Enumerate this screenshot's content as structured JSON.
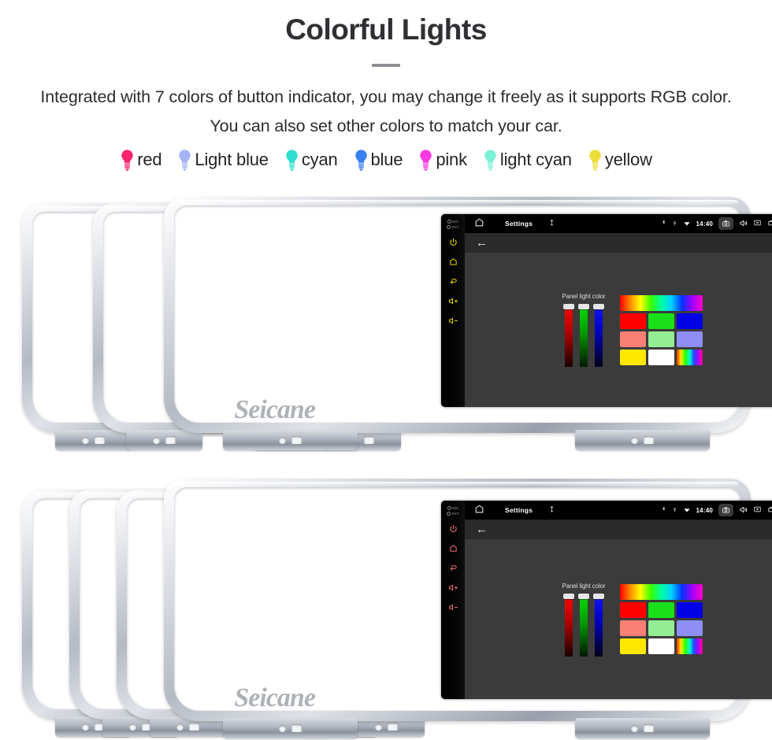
{
  "header": {
    "title": "Colorful Lights",
    "subtitle": "Integrated with 7 colors of button indicator, you may change it freely as it supports RGB color. You can also set other colors to match your car."
  },
  "legend": {
    "items": [
      {
        "label": "red",
        "color": "#f8246a",
        "icon": "bulb-icon"
      },
      {
        "label": "Light blue",
        "color": "#a5b4f5",
        "icon": "bulb-icon"
      },
      {
        "label": "cyan",
        "color": "#2fded0",
        "icon": "bulb-icon"
      },
      {
        "label": "blue",
        "color": "#3a7ff0",
        "icon": "bulb-icon"
      },
      {
        "label": "pink",
        "color": "#f93ae0",
        "icon": "bulb-icon"
      },
      {
        "label": "light cyan",
        "color": "#7df2d6",
        "icon": "bulb-icon"
      },
      {
        "label": "yellow",
        "color": "#ecdd3a",
        "icon": "bulb-icon"
      }
    ]
  },
  "screen": {
    "statusbar": {
      "home_icon": "home-icon",
      "title": "Settings",
      "mic_icon": "microphone-icon",
      "bluetooth_icon": "bluetooth-icon",
      "location_icon": "location-pin-icon",
      "wifi_icon": "wifi-icon",
      "time": "14:40",
      "camera_icon": "camera-icon",
      "volume_icon": "speaker-icon",
      "close_icon": "close-box-icon",
      "recents_icon": "recents-icon",
      "back_icon": "back-arrow-icon"
    },
    "actionbar": {
      "back_arrow": "←"
    },
    "panel": {
      "label": "Panel light color",
      "sliders": [
        {
          "name": "red",
          "value": 100,
          "color": "#ff0000"
        },
        {
          "name": "green",
          "value": 100,
          "color": "#00e000"
        },
        {
          "name": "blue",
          "value": 100,
          "color": "#1414ff"
        }
      ],
      "swatches": [
        "#ff0000",
        "#19e019",
        "#0000e6",
        "#fa8076",
        "#93ee93",
        "#8e8ef5",
        "#ffe800",
        "#ffffff",
        "multi"
      ],
      "rainbow_bar": "hue-spectrum"
    },
    "keys": {
      "mic_label": "MIC",
      "rst_label": "RST",
      "power_icon": "power-icon",
      "home_icon": "home-icon",
      "back_icon": "back-icon",
      "volume_up_icon": "volume-up-icon",
      "volume_down_icon": "volume-down-icon"
    },
    "watermark": "Seicane"
  },
  "rows": {
    "top": {
      "units": [
        {
          "key_color": "#1fd31f",
          "active": false
        },
        {
          "key_color": "#5f5fe8",
          "active": false
        },
        {
          "key_color": "#e6d700",
          "active": true
        }
      ]
    },
    "bottom": {
      "units": [
        {
          "key_color": "#e01414",
          "active": false
        },
        {
          "key_color": "#19d919",
          "active": false
        },
        {
          "key_color": "#2222ee",
          "active": false
        },
        {
          "key_color": "#e96f6f",
          "active": true
        }
      ]
    }
  }
}
